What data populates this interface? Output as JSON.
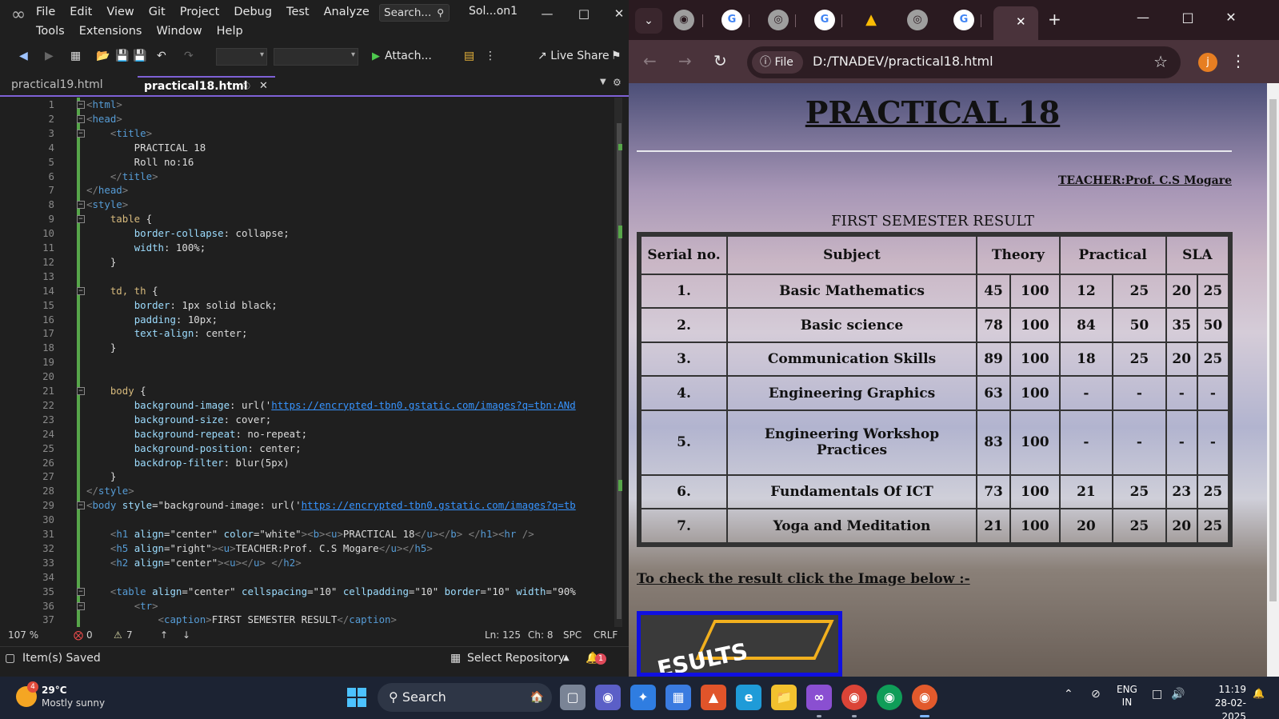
{
  "vs": {
    "menu_row1": [
      "File",
      "Edit",
      "View",
      "Git",
      "Project",
      "Debug",
      "Test",
      "Analyze"
    ],
    "menu_row2": [
      "Tools",
      "Extensions",
      "Window",
      "Help"
    ],
    "search": "Search...",
    "solution": "Sol...on1",
    "toolbar": {
      "attach": "Attach...",
      "live_share": "Live Share"
    },
    "tabs": {
      "inactive": "practical19.html",
      "active": "practical18.html"
    },
    "status": {
      "zoom": "107 %",
      "errors": "0",
      "warnings": "7",
      "line": "Ln: 125",
      "ch": "Ch: 8",
      "spc": "SPC",
      "crlf": "CRLF"
    },
    "bottom": {
      "saved": "Item(s) Saved",
      "repo": "Select Repository",
      "notif": "1"
    },
    "code": [
      {
        "n": "1",
        "t": "<html>"
      },
      {
        "n": "2",
        "t": "<head>"
      },
      {
        "n": "3",
        "t": "    <title>"
      },
      {
        "n": "4",
        "t": "        PRACTICAL 18"
      },
      {
        "n": "5",
        "t": "        Roll no:16"
      },
      {
        "n": "6",
        "t": "    </title>"
      },
      {
        "n": "7",
        "t": "</head>"
      },
      {
        "n": "8",
        "t": "<style>"
      },
      {
        "n": "9",
        "t": "    table {"
      },
      {
        "n": "10",
        "t": "        border-collapse: collapse;"
      },
      {
        "n": "11",
        "t": "        width: 100%;"
      },
      {
        "n": "12",
        "t": "    }"
      },
      {
        "n": "13",
        "t": ""
      },
      {
        "n": "14",
        "t": "    td, th {"
      },
      {
        "n": "15",
        "t": "        border: 1px solid black;"
      },
      {
        "n": "16",
        "t": "        padding: 10px;"
      },
      {
        "n": "17",
        "t": "        text-align: center;"
      },
      {
        "n": "18",
        "t": "    }"
      },
      {
        "n": "19",
        "t": ""
      },
      {
        "n": "20",
        "t": ""
      },
      {
        "n": "21",
        "t": "    body {"
      },
      {
        "n": "22",
        "t": "        background-image: url('https://encrypted-tbn0.gstatic.com/images?q=tbn:ANd"
      },
      {
        "n": "23",
        "t": "        background-size: cover;"
      },
      {
        "n": "24",
        "t": "        background-repeat: no-repeat;"
      },
      {
        "n": "25",
        "t": "        background-position: center;"
      },
      {
        "n": "26",
        "t": "        backdrop-filter: blur(5px)"
      },
      {
        "n": "27",
        "t": "    }"
      },
      {
        "n": "28",
        "t": "</style>"
      },
      {
        "n": "29",
        "t": "<body style=\"background-image: url('https://encrypted-tbn0.gstatic.com/images?q=tb"
      },
      {
        "n": "30",
        "t": ""
      },
      {
        "n": "31",
        "t": "    <h1 align=\"center\" color=\"white\"><b><u>PRACTICAL 18</u></b> </h1><hr />"
      },
      {
        "n": "32",
        "t": "    <h5 align=\"right\"><u>TEACHER:Prof. C.S Mogare</u></h5>"
      },
      {
        "n": "33",
        "t": "    <h2 align=\"center\"><u></u> </h2>"
      },
      {
        "n": "34",
        "t": ""
      },
      {
        "n": "35",
        "t": "    <table align=\"center\" cellspacing=\"10\" cellpadding=\"10\" border=\"10\" width=\"90%"
      },
      {
        "n": "36",
        "t": "        <tr>"
      },
      {
        "n": "37",
        "t": "            <caption>FIRST SEMESTER RESULT</caption>"
      }
    ]
  },
  "chrome": {
    "address_chip": "File",
    "url": "D:/TNADEV/practical18.html",
    "avatar": "j"
  },
  "page": {
    "title": "PRACTICAL 18",
    "teacher": "TEACHER:Prof. C.S Mogare",
    "caption": "FIRST SEMESTER RESULT",
    "headers": [
      "Serial no.",
      "Subject",
      "Theory",
      "Practical",
      "SLA"
    ],
    "rows": [
      [
        "1.",
        "Basic Mathematics",
        "45",
        "100",
        "12",
        "25",
        "20",
        "25"
      ],
      [
        "2.",
        "Basic science",
        "78",
        "100",
        "84",
        "50",
        "35",
        "50"
      ],
      [
        "3.",
        "Communication Skills",
        "89",
        "100",
        "18",
        "25",
        "20",
        "25"
      ],
      [
        "4.",
        "Engineering Graphics",
        "63",
        "100",
        "-",
        "-",
        "-",
        "-"
      ],
      [
        "5.",
        "Engineering Workshop Practices",
        "83",
        "100",
        "-",
        "-",
        "-",
        "-"
      ],
      [
        "6.",
        "Fundamentals Of ICT",
        "73",
        "100",
        "21",
        "25",
        "23",
        "25"
      ],
      [
        "7.",
        "Yoga and Meditation",
        "21",
        "100",
        "20",
        "25",
        "20",
        "25"
      ]
    ],
    "link_text": "To check the result click the Image below :-",
    "image_text": "ESULTS"
  },
  "taskbar": {
    "temp": "29°C",
    "weather": "Mostly sunny",
    "weather_badge": "4",
    "search": "Search",
    "lang1": "ENG",
    "lang2": "IN",
    "time": "11:19",
    "date": "28-02-2025"
  }
}
